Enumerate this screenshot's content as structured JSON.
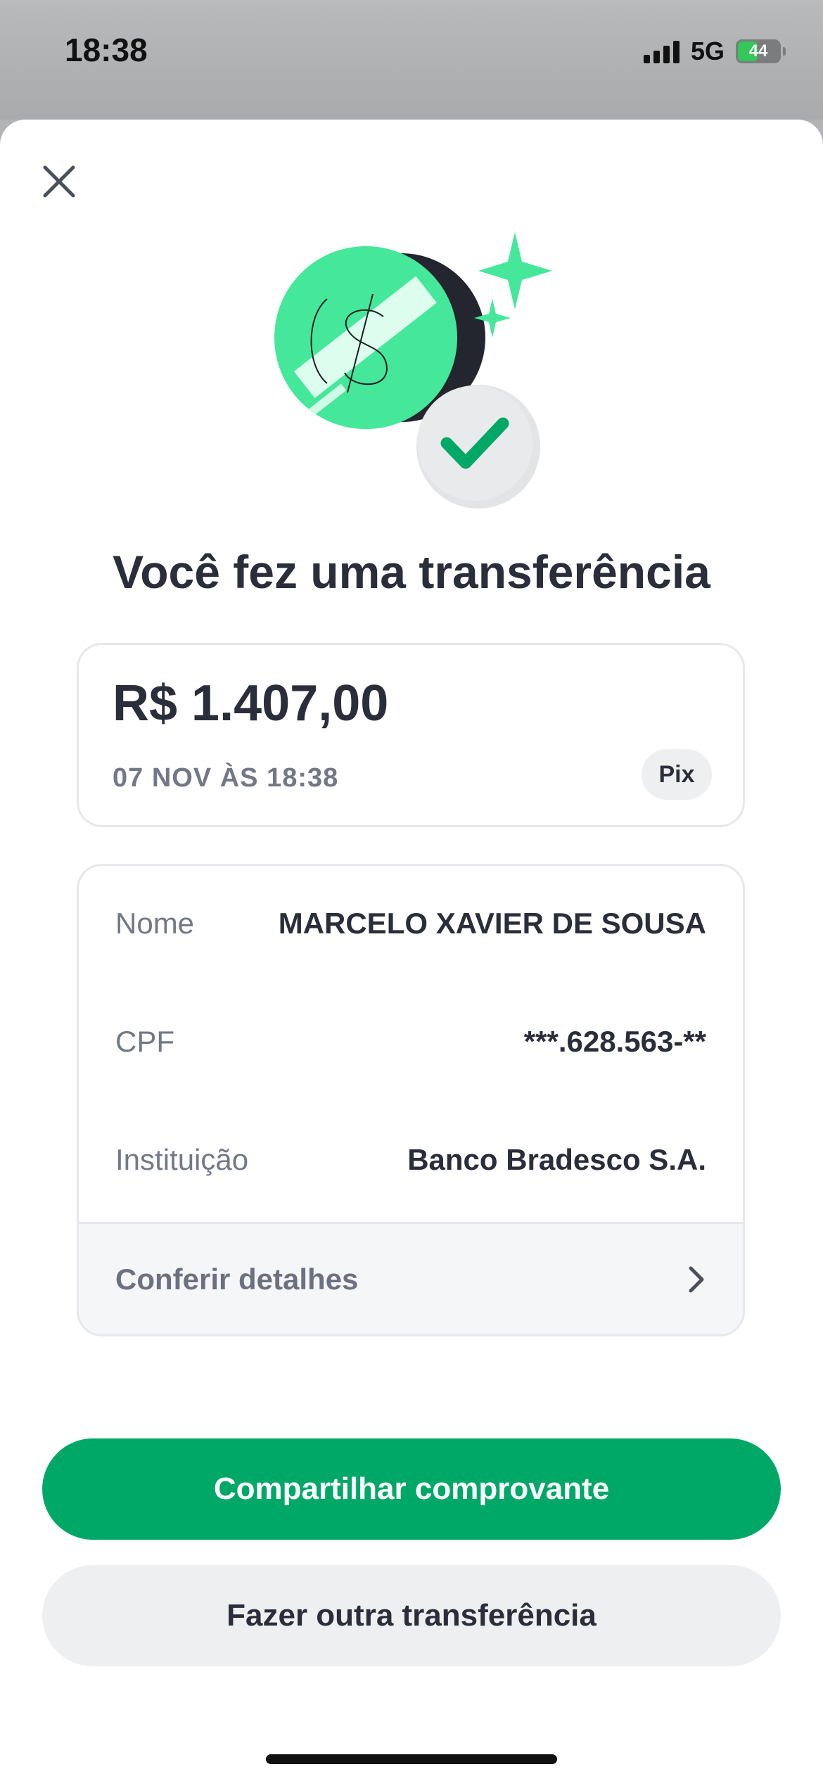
{
  "status_bar": {
    "time": "18:38",
    "network": "5G",
    "battery": "44"
  },
  "sheet": {
    "title": "Você fez uma transferência",
    "amount_card": {
      "amount": "R$ 1.407,00",
      "date": "07 NOV ÀS 18:38",
      "method_badge": "Pix"
    },
    "details": [
      {
        "label": "Nome",
        "value": "MARCELO XAVIER DE SOUSA"
      },
      {
        "label": "CPF",
        "value": "***.628.563-**"
      },
      {
        "label": "Instituição",
        "value": "Banco Bradesco S.A."
      }
    ],
    "check_details_label": "Conferir detalhes",
    "primary_button": "Compartilhar comprovante",
    "secondary_button": "Fazer outra transferência"
  },
  "colors": {
    "accent_green": "#00a868",
    "illustration_green": "#45e89a",
    "text_dark": "#2a2e3a",
    "text_muted": "#727886"
  },
  "icons": [
    "close-icon",
    "money-success-illustration",
    "checkmark-icon",
    "sparkle-icon",
    "chevron-right-icon"
  ]
}
